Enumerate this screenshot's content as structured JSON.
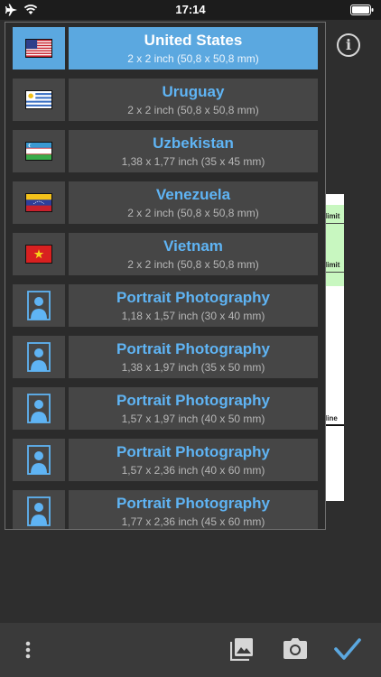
{
  "status_bar": {
    "time": "17:14"
  },
  "colors": {
    "accent": "#5ba8e0",
    "title_text": "#5fb4f4",
    "row_bg": "#464646",
    "background": "#2e2e2e"
  },
  "canvas": {
    "limit_label_1": "limit",
    "limit_label_2": "limit",
    "line_label": "line"
  },
  "countries": [
    {
      "name": "United States",
      "size": "2 x 2 inch (50,8 x 50,8 mm)",
      "icon": "us-flag-icon",
      "selected": true
    },
    {
      "name": "Uruguay",
      "size": "2 x 2 inch (50,8 x 50,8 mm)",
      "icon": "uruguay-flag-icon"
    },
    {
      "name": "Uzbekistan",
      "size": "1,38 x 1,77 inch (35 x 45 mm)",
      "icon": "uzbekistan-flag-icon"
    },
    {
      "name": "Venezuela",
      "size": "2 x 2 inch (50,8 x 50,8 mm)",
      "icon": "venezuela-flag-icon"
    },
    {
      "name": "Vietnam",
      "size": "2 x 2 inch (50,8 x 50,8 mm)",
      "icon": "vietnam-flag-icon"
    }
  ],
  "portraits": [
    {
      "name": "Portrait Photography",
      "size": "1,18 x 1,57 inch (30 x 40 mm)",
      "icon": "portrait-icon"
    },
    {
      "name": "Portrait Photography",
      "size": "1,38 x 1,97 inch (35 x 50 mm)",
      "icon": "portrait-icon"
    },
    {
      "name": "Portrait Photography",
      "size": "1,57 x 1,97 inch (40 x 50 mm)",
      "icon": "portrait-icon"
    },
    {
      "name": "Portrait Photography",
      "size": "1,57 x 2,36 inch (40 x 60 mm)",
      "icon": "portrait-icon"
    },
    {
      "name": "Portrait Photography",
      "size": "1,77 x 2,36 inch (45 x 60 mm)",
      "icon": "portrait-icon"
    }
  ],
  "toolbar": {
    "icons": [
      "more-vertical-icon",
      "photo-gallery-icon",
      "camera-icon",
      "checkmark-icon"
    ]
  }
}
